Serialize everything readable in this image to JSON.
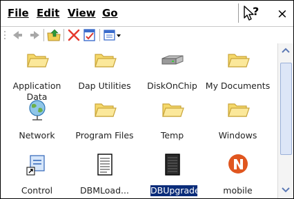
{
  "menu": {
    "file": "File",
    "edit": "Edit",
    "view": "View",
    "go": "Go"
  },
  "titlebar": {
    "close_glyph": "×",
    "help_icon": "pointer-help-icon"
  },
  "toolbar": {
    "icons": [
      "back-arrow-icon",
      "forward-arrow-icon",
      "up-folder-icon",
      "delete-x-icon",
      "properties-icon",
      "views-menu-icon"
    ]
  },
  "items": [
    {
      "label": "Application Data",
      "icon": "folder-icon"
    },
    {
      "label": "Dap Utilities",
      "icon": "folder-icon"
    },
    {
      "label": "DiskOnChip",
      "icon": "disk-drive-icon"
    },
    {
      "label": "My Documents",
      "icon": "folder-icon"
    },
    {
      "label": "Network",
      "icon": "network-icon"
    },
    {
      "label": "Program Files",
      "icon": "folder-icon"
    },
    {
      "label": "Temp",
      "icon": "folder-icon"
    },
    {
      "label": "Windows",
      "icon": "folder-icon"
    },
    {
      "label": "Control",
      "icon": "shortcut-icon"
    },
    {
      "label": "DBMLoad...",
      "icon": "document-icon"
    },
    {
      "label": "DBUpgrade",
      "icon": "dark-document-icon",
      "selected": true
    },
    {
      "label": "mobile",
      "icon": "n-logo-icon"
    }
  ],
  "colors": {
    "selection": "#0b2d7a",
    "folder": "#f5d86a",
    "folder_edge": "#c9a53a",
    "delete": "#e63a2e"
  }
}
